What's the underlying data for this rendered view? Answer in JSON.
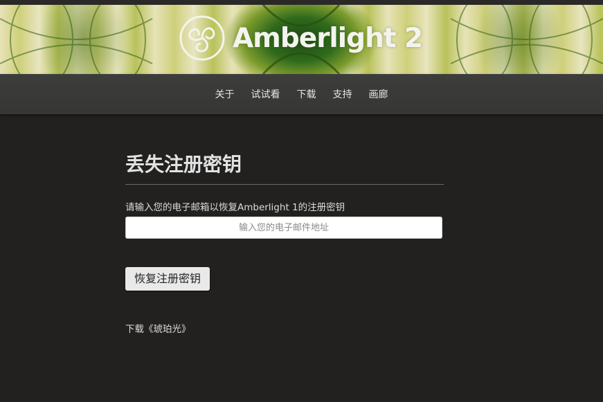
{
  "banner": {
    "app_name": "Amberlight 2"
  },
  "nav": {
    "items": [
      {
        "label": "关于"
      },
      {
        "label": "试试看"
      },
      {
        "label": "下载"
      },
      {
        "label": "支持"
      },
      {
        "label": "画廊"
      }
    ]
  },
  "main": {
    "title": "丢失注册密钥",
    "instruction": "请输入您的电子邮箱以恢复Amberlight 1的注册密钥",
    "email_input": {
      "value": "",
      "placeholder": "输入您的电子邮件地址"
    },
    "submit_label": "恢复注册密钥",
    "download_link": "下载《琥珀光》"
  },
  "colors": {
    "background": "#222120",
    "nav_background": "#3a3a39",
    "button_background": "#e9e9e9",
    "text": "#dcdcdc"
  }
}
